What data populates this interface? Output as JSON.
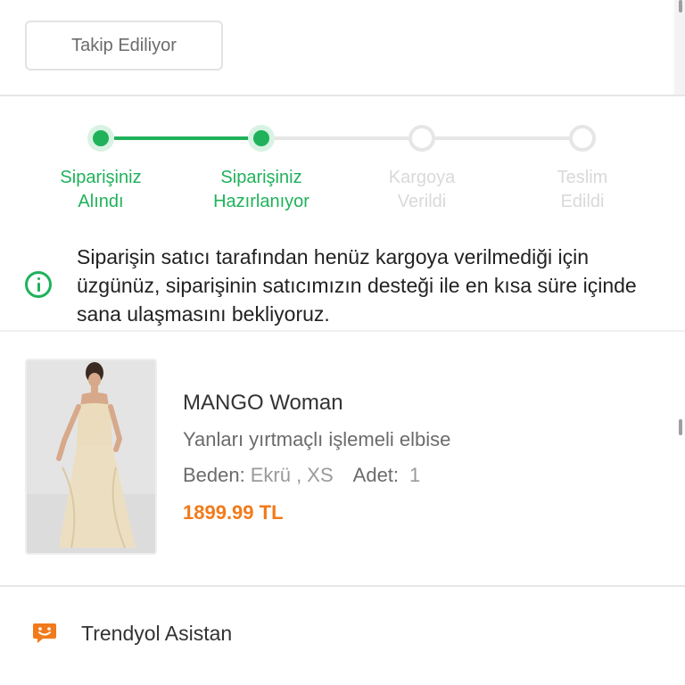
{
  "header": {
    "follow_button_label": "Takip Ediliyor"
  },
  "order_status": {
    "steps": [
      {
        "label_line1": "Siparişiniz",
        "label_line2": "Alındı",
        "state": "done"
      },
      {
        "label_line1": "Siparişiniz",
        "label_line2": "Hazırlanıyor",
        "state": "done"
      },
      {
        "label_line1": "Kargoya",
        "label_line2": "Verildi",
        "state": "todo"
      },
      {
        "label_line1": "Teslim",
        "label_line2": "Edildi",
        "state": "todo"
      }
    ],
    "active_color": "#1fb25a",
    "inactive_color": "#e6e6e6"
  },
  "notice": {
    "icon": "info-icon",
    "text": "Siparişin satıcı tarafından henüz kargoya verilmediği için üzgünüz, siparişinin satıcımızın desteği ile en kısa süre içinde sana ulaşmasını bekliyoruz."
  },
  "product": {
    "brand": "MANGO Woman",
    "name": "Yanları yırtmaçlı işlemeli elbise",
    "size_label": "Beden:",
    "size_value": "Ekrü , XS",
    "qty_label": "Adet:",
    "qty_value": "1",
    "price": "1899.99 TL",
    "price_color": "#f27a1a"
  },
  "assistant": {
    "icon": "chat-bot-icon",
    "label": "Trendyol Asistan",
    "icon_color": "#f27a1a"
  }
}
